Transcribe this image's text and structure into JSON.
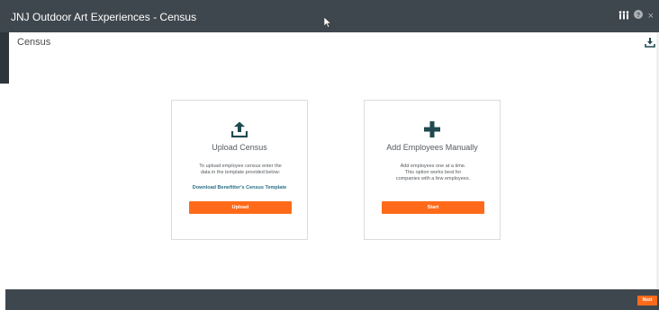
{
  "window": {
    "title": "JNJ Outdoor Art Experiences - Census",
    "icons": [
      "people-icon",
      "help-icon",
      "close-icon"
    ]
  },
  "page": {
    "title": "Census",
    "download_icon": "download-icon"
  },
  "cards": {
    "upload": {
      "icon": "upload-icon",
      "title": "Upload Census",
      "description_line1": "To upload employee census enter the",
      "description_line2": "data in the template provided below:",
      "link": "Download Benefitter's Census Template",
      "button": "Upload"
    },
    "manual": {
      "icon": "plus-icon",
      "title": "Add Employees Manually",
      "description_line1": "Add employees one at a time.",
      "description_line2": "This option works best for",
      "description_line3": "companies with a few employees.",
      "button": "Start"
    }
  },
  "footer": {
    "next": "Next"
  },
  "colors": {
    "titlebar": "#3f474e",
    "accent": "#ff6a1a",
    "icon_dark": "#1f4a4f",
    "link": "#2a6f86"
  }
}
